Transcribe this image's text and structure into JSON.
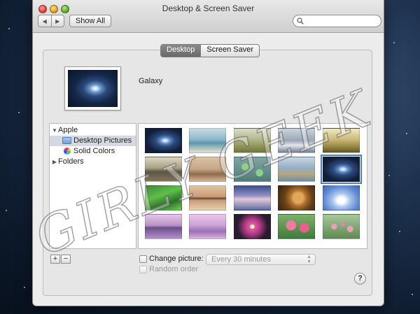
{
  "window": {
    "title": "Desktop & Screen Saver",
    "show_all_label": "Show All",
    "back_glyph": "◀",
    "forward_glyph": "▶",
    "search_placeholder": ""
  },
  "tabs": [
    {
      "label": "Desktop",
      "active": true
    },
    {
      "label": "Screen Saver",
      "active": false
    }
  ],
  "preview": {
    "name": "Galaxy"
  },
  "sources": [
    {
      "label": "Apple",
      "icon": "disclosure-down-icon",
      "expanded": true
    },
    {
      "label": "Desktop Pictures",
      "icon": "folder-icon",
      "selected": true
    },
    {
      "label": "Solid Colors",
      "icon": "color-wheel-icon"
    },
    {
      "label": "Folders",
      "icon": "disclosure-right-icon",
      "expanded": false
    }
  ],
  "disclosure_glyphs": {
    "expanded": "▼",
    "collapsed": "▶"
  },
  "thumbnails": [
    {
      "id": "galaxy",
      "selected": false
    },
    {
      "id": "beach"
    },
    {
      "id": "grass"
    },
    {
      "id": "fog"
    },
    {
      "id": "sunlit-grass"
    },
    {
      "id": "elephant"
    },
    {
      "id": "lake-birds"
    },
    {
      "id": "lily-pads"
    },
    {
      "id": "water"
    },
    {
      "id": "galaxy-selected",
      "selected": true
    },
    {
      "id": "green-grass"
    },
    {
      "id": "island"
    },
    {
      "id": "lake-sky"
    },
    {
      "id": "lion"
    },
    {
      "id": "blue-sky"
    },
    {
      "id": "mountain-pink"
    },
    {
      "id": "purple-mist"
    },
    {
      "id": "lotus"
    },
    {
      "id": "pink-flowers"
    },
    {
      "id": "pink-berries"
    }
  ],
  "controls": {
    "add_label": "+",
    "remove_label": "−",
    "change_picture_label": "Change picture:",
    "interval_value": "Every 30 minutes",
    "random_order_label": "Random order",
    "help_label": "?"
  },
  "watermark_text": "GIRLY GEEK",
  "colors": {
    "selection": "#4a7fd0",
    "window_bg": "#ececec"
  }
}
